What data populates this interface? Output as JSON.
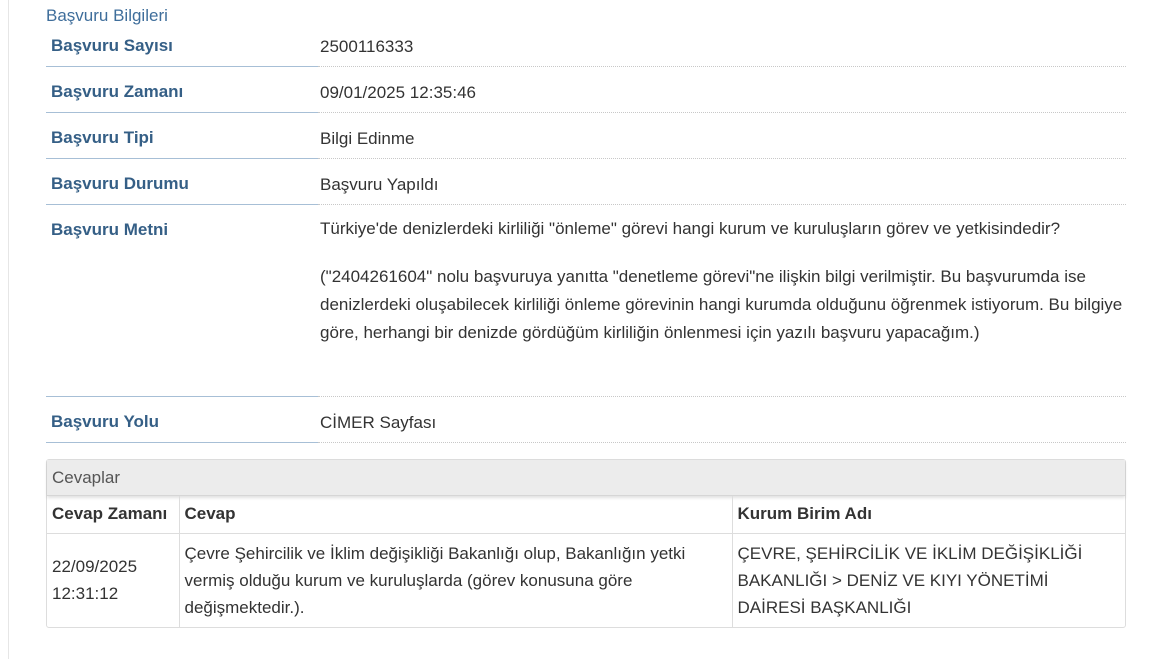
{
  "section_title": "Başvuru Bilgileri",
  "info_rows": [
    {
      "label": "Başvuru Sayısı",
      "value": "2500116333"
    },
    {
      "label": "Başvuru Zamanı",
      "value": "09/01/2025 12:35:46"
    },
    {
      "label": "Başvuru Tipi",
      "value": "Bilgi Edinme"
    },
    {
      "label": "Başvuru Durumu",
      "value": "Başvuru Yapıldı"
    },
    {
      "label": "Başvuru Metni",
      "paragraph1": "Türkiye'de denizlerdeki kirliliği \"önleme\" görevi hangi kurum ve kuruluşların görev ve yetkisindedir?",
      "paragraph2": "(\"2404261604\" nolu başvuruya yanıtta \"denetleme görevi\"ne ilişkin bilgi verilmiştir. Bu başvurumda ise denizlerdeki oluşabilecek kirliliği önleme görevinin hangi kurumda olduğunu öğrenmek istiyorum. Bu bilgiye göre, herhangi bir denizde gördüğüm kirliliğin önlenmesi için yazılı başvuru yapacağım.)"
    },
    {
      "label": "Başvuru Yolu",
      "value": "CİMER Sayfası"
    }
  ],
  "answers": {
    "title": "Cevaplar",
    "columns": [
      "Cevap Zamanı",
      "Cevap",
      "Kurum Birim Adı"
    ],
    "rows": [
      {
        "time_date": "22/09/2025",
        "time_clock": "12:31:12",
        "answer": "Çevre Şehircilik ve İklim değişikliği Bakanlığı olup, Bakanlığın yetki vermiş olduğu kurum ve kuruluşlarda (görev konusuna göre değişmektedir.).",
        "unit": "ÇEVRE, ŞEHİRCİLİK VE İKLİM DEĞİŞİKLİĞİ BAKANLIĞI > DENİZ VE KIYI YÖNETİMİ DAİRESİ BAŞKANLIĞI"
      }
    ]
  }
}
